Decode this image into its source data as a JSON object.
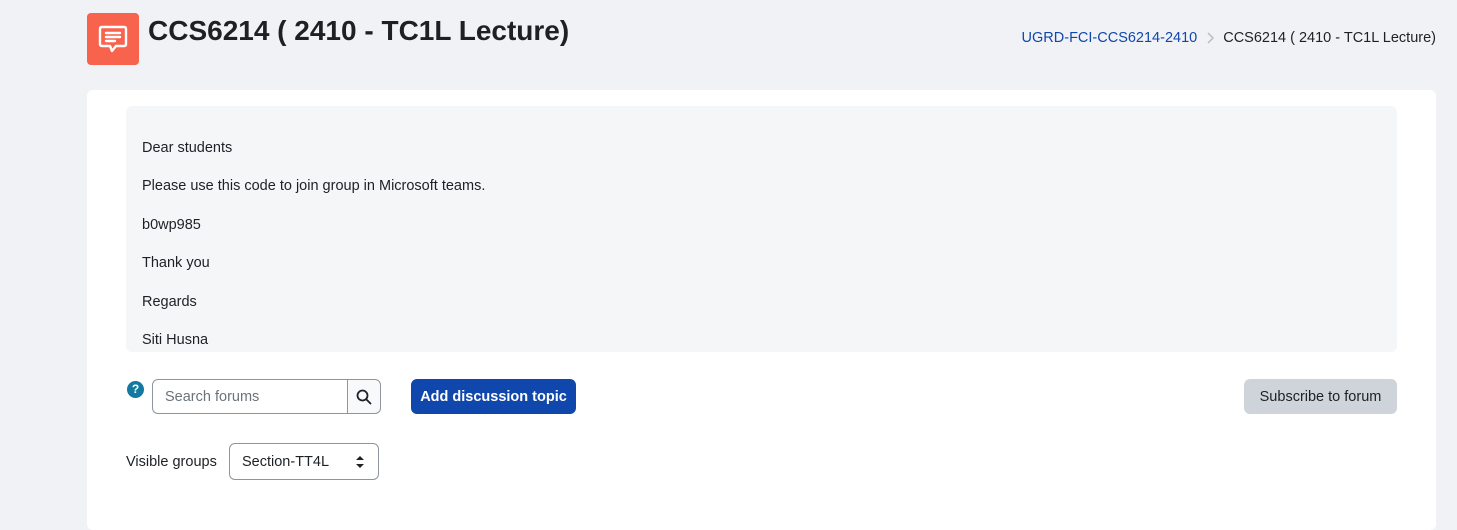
{
  "header": {
    "title": "CCS6214 ( 2410 - TC1L Lecture)",
    "activity_icon": "forum-chat-icon",
    "accent_color": "#f7634d",
    "breadcrumb": {
      "course_link": "UGRD-FCI-CCS6214-2410",
      "current": "CCS6214 ( 2410 - TC1L Lecture)"
    }
  },
  "intro": {
    "lines": [
      "Dear students",
      "Please use this code to join group in Microsoft teams.",
      "b0wp985",
      "Thank you",
      "Regards",
      "Siti Husna"
    ]
  },
  "controls": {
    "help_icon_label": "?",
    "search_placeholder": "Search forums",
    "search_value": "",
    "add_topic_label": "Add discussion topic",
    "subscribe_label": "Subscribe to forum",
    "primary_color": "#0f47ad"
  },
  "groups": {
    "label": "Visible groups",
    "selected": "Section-TT4L"
  }
}
